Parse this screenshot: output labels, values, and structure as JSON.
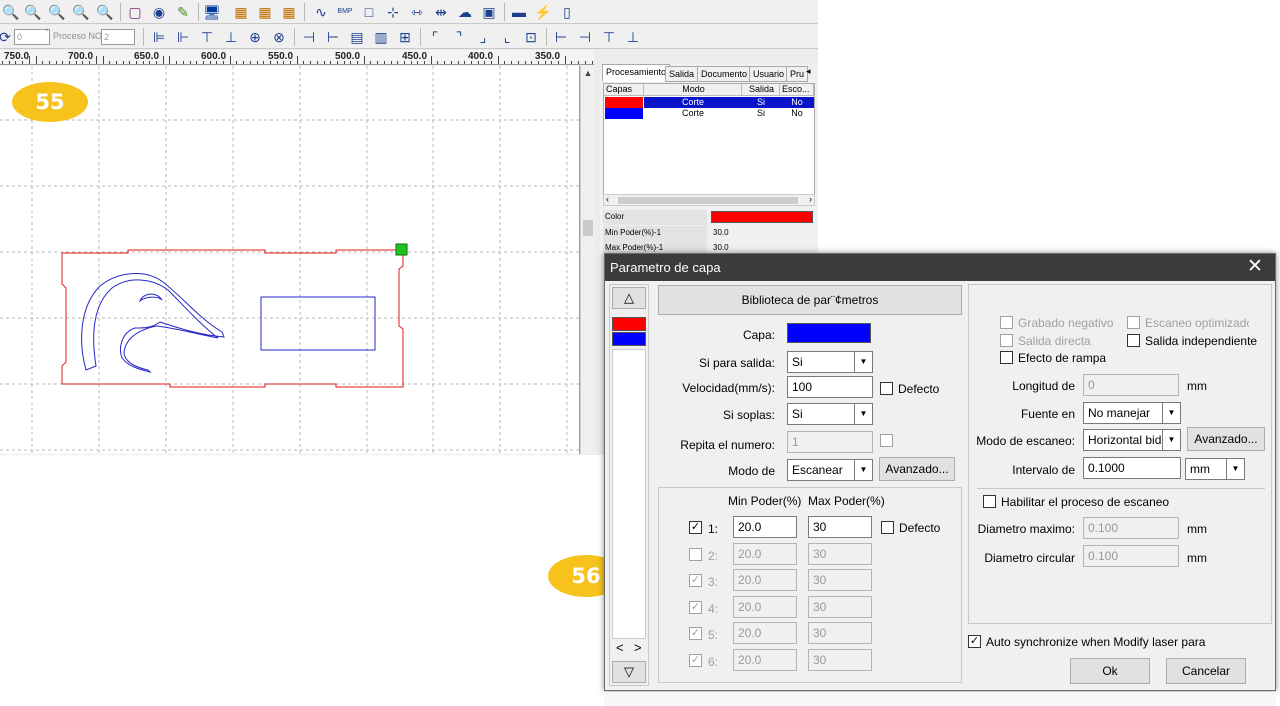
{
  "toolbar2": {
    "angle_value": "0",
    "proceso_label": "Proceso NO:",
    "proceso_value": "2"
  },
  "ruler": {
    "labels": [
      "750.0",
      "700.0",
      "650.0",
      "600.0",
      "550.0",
      "500.0",
      "450.0",
      "400.0",
      "350.0"
    ]
  },
  "badges": {
    "first": "55",
    "second": "56"
  },
  "panel": {
    "tabs": [
      "Procesamiento",
      "Salida",
      "Documento",
      "Usuario",
      "Pru"
    ],
    "table_headers": [
      "Capas",
      "Modo",
      "Salida",
      "Esco..."
    ],
    "rows": [
      {
        "color": "#ff0000",
        "mode": "Corte",
        "salida": "Si",
        "esc": "No",
        "selected": true
      },
      {
        "color": "#0000ff",
        "mode": "Corte",
        "salida": "Si",
        "esc": "No",
        "selected": false
      }
    ],
    "props": [
      {
        "key": "Color",
        "value": ""
      },
      {
        "key": "Min Poder(%)-1",
        "value": "30.0"
      },
      {
        "key": "Max Poder(%)-1",
        "value": "30.0"
      }
    ]
  },
  "colors": {
    "red": "#ff0000",
    "blue": "#0000ff",
    "dark_title": "#3b3b3b",
    "badge": "#f6c21b"
  },
  "dialog": {
    "title": "Parametro de capa",
    "library_button": "Biblioteca de par¨¢metros",
    "capa_label": "Capa:",
    "salida_label": "Si para salida:",
    "salida_value": "Si",
    "velocidad_label": "Velocidad(mm/s):",
    "velocidad_value": "100",
    "defecto_label": "Defecto",
    "soplas_label": "Si soplas:",
    "soplas_value": "Si",
    "repita_label": "Repita el numero:",
    "repita_value": "1",
    "modo_label": "Modo de",
    "modo_value": "Escanear",
    "avanzado_label": "Avanzado...",
    "min_poder_header": "Min Poder(%)",
    "max_poder_header": "Max Poder(%)",
    "power_rows": [
      {
        "label": "1:",
        "min": "20.0",
        "max": "30",
        "checked": true,
        "enabled": true
      },
      {
        "label": "2:",
        "min": "20.0",
        "max": "30",
        "checked": false,
        "enabled": false
      },
      {
        "label": "3:",
        "min": "20.0",
        "max": "30",
        "checked": true,
        "enabled": false
      },
      {
        "label": "4:",
        "min": "20.0",
        "max": "30",
        "checked": true,
        "enabled": false
      },
      {
        "label": "5:",
        "min": "20.0",
        "max": "30",
        "checked": true,
        "enabled": false
      },
      {
        "label": "6:",
        "min": "20.0",
        "max": "30",
        "checked": true,
        "enabled": false
      }
    ],
    "grabado_negativo": "Grabado negativo",
    "escaneo_optimizado": "Escaneo optimizado",
    "salida_directa": "Salida directa",
    "salida_independiente": "Salida independiente",
    "efecto_rampa": "Efecto de rampa",
    "longitud_label": "Longitud de",
    "longitud_value": "0",
    "unit_mm": "mm",
    "fuente_label": "Fuente en",
    "fuente_value": "No manejar",
    "modo_escaneo_label": "Modo de escaneo:",
    "modo_escaneo_value": "Horizontal bidi",
    "intervalo_label": "Intervalo de",
    "intervalo_value": "0.1000",
    "intervalo_unit": "mm",
    "habilitar_label": "Habilitar el proceso de escaneo",
    "diametro_max_label": "Diametro maximo:",
    "diametro_max_value": "0.100",
    "diametro_circ_label": "Diametro circular",
    "diametro_circ_value": "0.100",
    "auto_sync_label": "Auto synchronize when Modify laser para",
    "ok_label": "Ok",
    "cancel_label": "Cancelar",
    "nav_left": "<",
    "nav_right": ">"
  }
}
